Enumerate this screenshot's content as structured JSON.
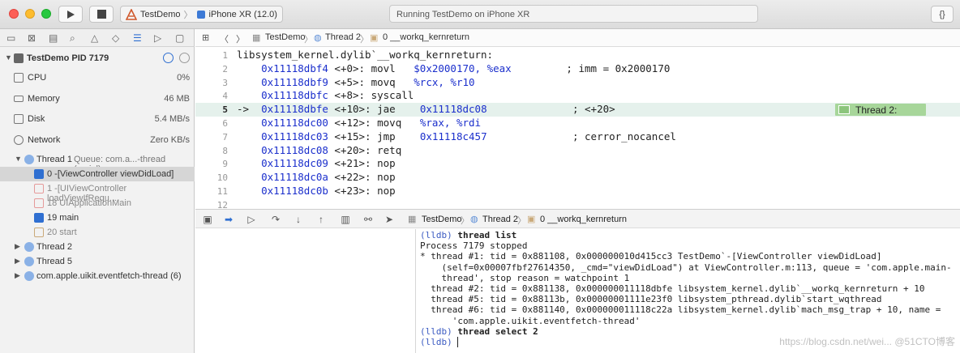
{
  "toolbar": {
    "scheme": "TestDemo",
    "device": "iPhone XR (12.0)",
    "status": "Running TestDemo on iPhone XR",
    "library_button": "{}"
  },
  "debug_navigator": {
    "process": "TestDemo PID 7179",
    "gauges": [
      {
        "label": "CPU",
        "value": "0%"
      },
      {
        "label": "Memory",
        "value": "46 MB"
      },
      {
        "label": "Disk",
        "value": "5.4 MB/s"
      },
      {
        "label": "Network",
        "value": "Zero KB/s"
      }
    ],
    "thread1": "Thread 1",
    "thread1_queue": "Queue: com.a...-thread (serial)",
    "frames": [
      {
        "label": "0 -[ViewController viewDidLoad]"
      },
      {
        "label": "1 -[UIViewController loadViewIfRequ..."
      },
      {
        "label": "18 UIApplicationMain"
      },
      {
        "label": "19 main"
      },
      {
        "label": "20 start"
      }
    ],
    "other_threads": [
      {
        "label": "Thread 2"
      },
      {
        "label": "Thread 5"
      },
      {
        "label": "com.apple.uikit.eventfetch-thread (6)"
      }
    ]
  },
  "jump_bar": {
    "project": "TestDemo",
    "thread": "Thread 2",
    "frame": "0 __workq_kernreturn"
  },
  "editor": {
    "lines": [
      {
        "n": "1",
        "pre": "libsystem_kernel.dylib`__workq_kernreturn:",
        "addr": "",
        "off": "",
        "ins": "",
        "op": "",
        "cm": ""
      },
      {
        "n": "2",
        "pre": "    ",
        "addr": "0x11118dbf4",
        "off": " <+0>: ",
        "ins": "movl   ",
        "op": "$0x2000170, %eax",
        "cm": "         ; imm = 0x2000170"
      },
      {
        "n": "3",
        "pre": "    ",
        "addr": "0x11118dbf9",
        "off": " <+5>: ",
        "ins": "movq   ",
        "op": "%rcx, %r10",
        "cm": ""
      },
      {
        "n": "4",
        "pre": "    ",
        "addr": "0x11118dbfc",
        "off": " <+8>: ",
        "ins": "syscall",
        "op": "",
        "cm": ""
      },
      {
        "n": "5",
        "pre": "->  ",
        "addr": "0x11118dbfe",
        "off": " <+10>: ",
        "ins": "jae    ",
        "op": "0x11118dc08",
        "cm": "              ; <+20>"
      },
      {
        "n": "6",
        "pre": "    ",
        "addr": "0x11118dc00",
        "off": " <+12>: ",
        "ins": "movq   ",
        "op": "%rax, %rdi",
        "cm": ""
      },
      {
        "n": "7",
        "pre": "    ",
        "addr": "0x11118dc03",
        "off": " <+15>: ",
        "ins": "jmp    ",
        "op": "0x11118c457",
        "cm": "              ; cerror_nocancel"
      },
      {
        "n": "8",
        "pre": "    ",
        "addr": "0x11118dc08",
        "off": " <+20>: ",
        "ins": "retq",
        "op": "",
        "cm": ""
      },
      {
        "n": "9",
        "pre": "    ",
        "addr": "0x11118dc09",
        "off": " <+21>: ",
        "ins": "nop",
        "op": "",
        "cm": ""
      },
      {
        "n": "10",
        "pre": "    ",
        "addr": "0x11118dc0a",
        "off": " <+22>: ",
        "ins": "nop",
        "op": "",
        "cm": ""
      },
      {
        "n": "11",
        "pre": "    ",
        "addr": "0x11118dc0b",
        "off": " <+23>: ",
        "ins": "nop",
        "op": "",
        "cm": ""
      },
      {
        "n": "12",
        "pre": "",
        "addr": "",
        "off": "",
        "ins": "",
        "op": "",
        "cm": ""
      }
    ],
    "badge": "Thread 2:"
  },
  "debug_bar": {
    "project": "TestDemo",
    "thread": "Thread 2",
    "frame": "0 __workq_kernreturn"
  },
  "console": {
    "lines": [
      {
        "p": "(lldb) ",
        "c": "thread list",
        "bold": true
      },
      {
        "p": "",
        "c": "Process 7179 stopped",
        "bold": false
      },
      {
        "p": "",
        "c": "* thread #1: tid = 0x881108, 0x000000010d415cc3 TestDemo`-[ViewController viewDidLoad]",
        "bold": false
      },
      {
        "p": "",
        "c": "    (self=0x00007fbf27614350, _cmd=\"viewDidLoad\") at ViewController.m:113, queue = 'com.apple.main-",
        "bold": false
      },
      {
        "p": "",
        "c": "    thread', stop reason = watchpoint 1",
        "bold": false
      },
      {
        "p": "",
        "c": "  thread #2: tid = 0x881138, 0x000000011118dbfe libsystem_kernel.dylib`__workq_kernreturn + 10",
        "bold": false
      },
      {
        "p": "",
        "c": "  thread #5: tid = 0x88113b, 0x00000001111e23f0 libsystem_pthread.dylib`start_wqthread",
        "bold": false
      },
      {
        "p": "",
        "c": "  thread #6: tid = 0x881140, 0x000000011118c22a libsystem_kernel.dylib`mach_msg_trap + 10, name =",
        "bold": false
      },
      {
        "p": "",
        "c": "      'com.apple.uikit.eventfetch-thread'",
        "bold": false
      },
      {
        "p": "(lldb) ",
        "c": "thread select 2",
        "bold": true
      },
      {
        "p": "(lldb) ",
        "c": "",
        "bold": false
      }
    ]
  },
  "watermark": "https://blog.csdn.net/wei... @51CTO博客"
}
